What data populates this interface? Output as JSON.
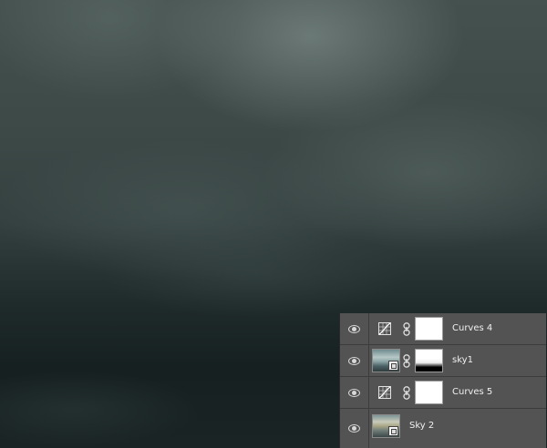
{
  "layers_panel": {
    "layers": [
      {
        "name": "Curves 4",
        "kind": "curves-adjustment",
        "visible": true,
        "mask": "white"
      },
      {
        "name": "sky1",
        "kind": "smart-object",
        "visible": true,
        "mask": "gradient"
      },
      {
        "name": "Curves 5",
        "kind": "curves-adjustment",
        "visible": true,
        "mask": "white"
      },
      {
        "name": "Sky 2",
        "kind": "smart-object",
        "visible": true,
        "mask": "none"
      }
    ]
  },
  "icons": {
    "visibility": "eye-icon",
    "adjustment": "curves-icon",
    "link": "link-icon",
    "smart_object": "smart-object-badge-icon"
  },
  "colors": {
    "panel_bg": "#535353",
    "panel_divider": "#3c3c3c",
    "text": "#f0f0f0"
  }
}
